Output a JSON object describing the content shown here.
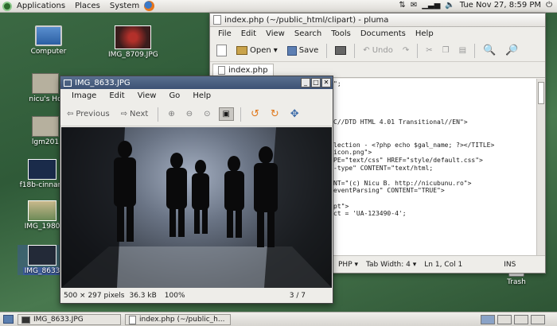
{
  "top_panel": {
    "menus": [
      "Applications",
      "Places",
      "System"
    ],
    "datetime": "Tue Nov 27,  8:59 PM"
  },
  "desktop": {
    "icons": [
      {
        "label": "Computer",
        "icon": "computer-icon"
      },
      {
        "label": "IMG_8709.JPG",
        "icon": "image-thumbnail"
      },
      {
        "label": "nicu's Ho",
        "icon": "home-folder-icon"
      },
      {
        "label": "lgm201",
        "icon": "folder-icon"
      },
      {
        "label": "f18b-cinnam",
        "icon": "image-thumbnail"
      },
      {
        "label": "IMG_1980",
        "icon": "image-thumbnail"
      },
      {
        "label": "IMG_8633",
        "icon": "image-thumbnail"
      },
      {
        "label": "Trash",
        "icon": "trash-icon"
      }
    ]
  },
  "pluma": {
    "title": "index.php (~/public_html/clipart) - pluma",
    "menu": [
      "File",
      "Edit",
      "View",
      "Search",
      "Tools",
      "Documents",
      "Help"
    ],
    "toolbar": {
      "open": "Open",
      "save": "Save",
      "undo": "Undo"
    },
    "tab": "index.php",
    "code_lines": [
      "\";",
      "",
      "",
      "",
      "",
      "C//DTD HTML 4.01 Transitional//EN\">",
      "",
      "",
      "lection - <?php echo $gal_name; ?></TITLE>",
      "icon.png\">",
      "PE=\"text/css\" HREF=\"style/default.css\">",
      "-type\" CONTENT=\"text/html;",
      "",
      "NT=\"(c) Nicu B. http://nicubunu.ro\">",
      "eventParsing\" CONTENT=\"TRUE\">",
      "",
      "pt\">",
      "ct = 'UA-123490-4';"
    ],
    "status": {
      "language": "PHP",
      "tab_width": "Tab Width: 4",
      "position": "Ln 1, Col 1",
      "mode": "INS"
    }
  },
  "viewer": {
    "title": "IMG_8633.JPG",
    "menu": [
      "Image",
      "Edit",
      "View",
      "Go",
      "Help"
    ],
    "toolbar": {
      "previous": "Previous",
      "next": "Next"
    },
    "status": {
      "dimensions": "500 × 297 pixels",
      "size": "36.3 kB",
      "zoom": "100%",
      "index": "3 / 7"
    }
  },
  "taskbar": {
    "items": [
      "IMG_8633.JPG",
      "index.php (~/public_h..."
    ]
  },
  "colors": {
    "desktop_green": "#3c6a44",
    "selection_blue": "#3d5274"
  }
}
